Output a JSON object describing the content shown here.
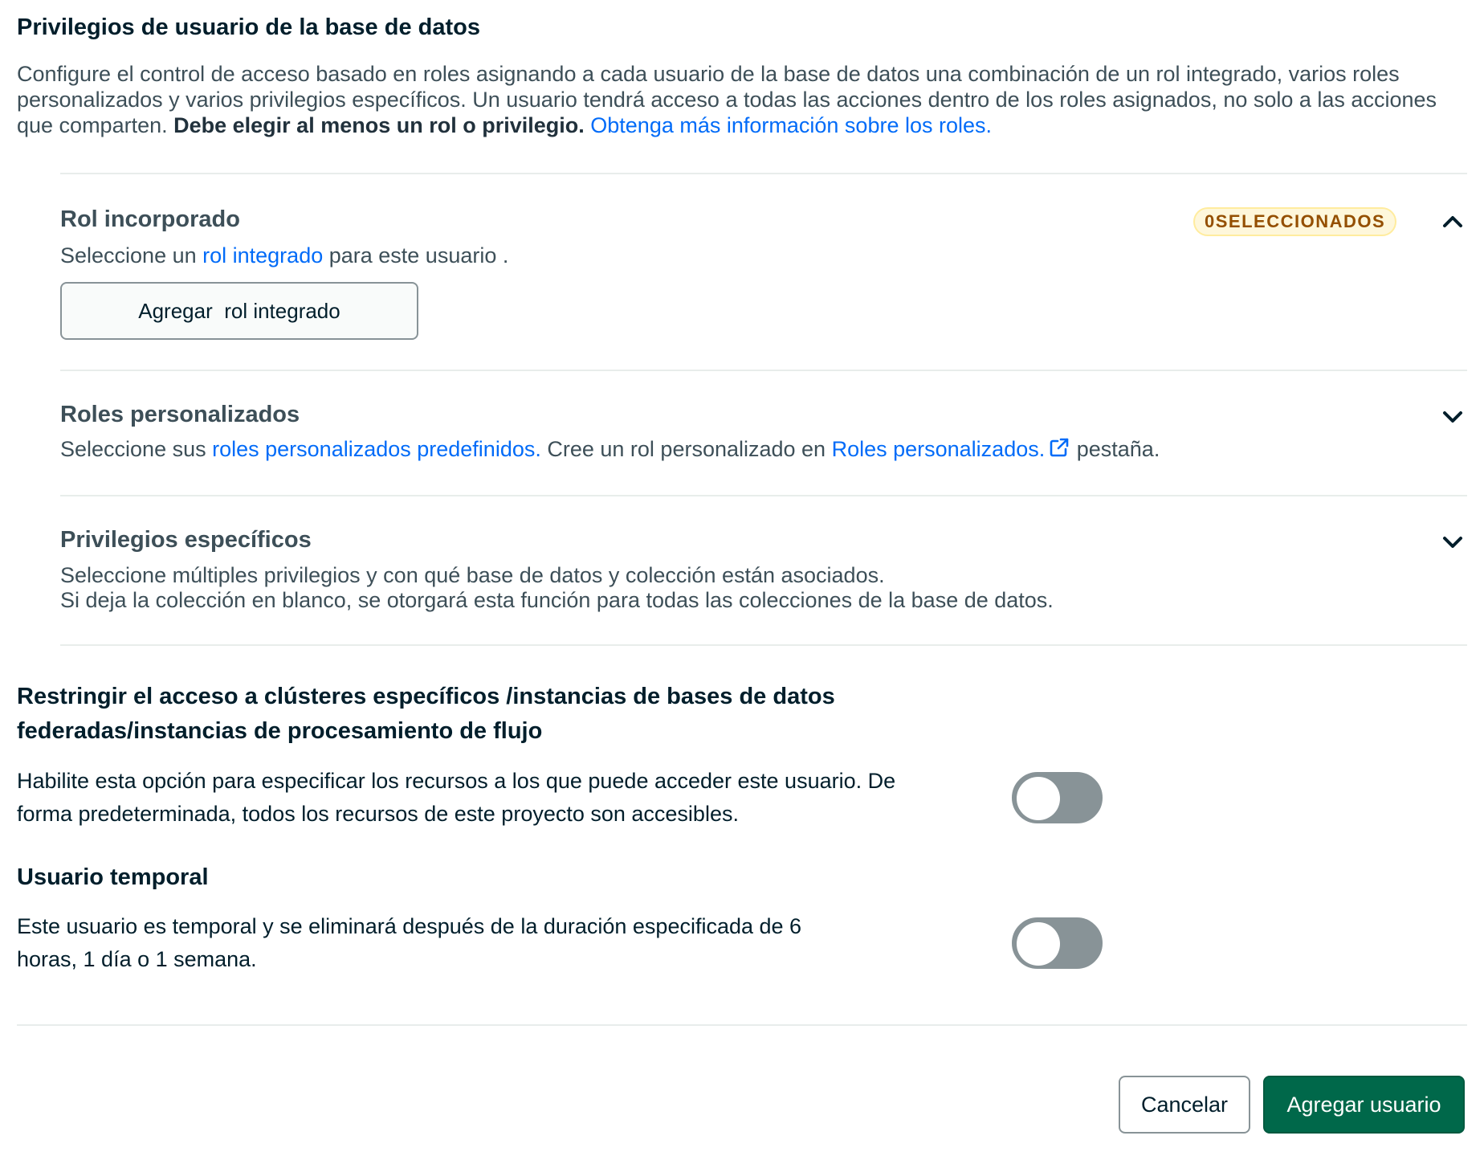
{
  "header": {
    "title": "Privilegios de usuario de la base de datos",
    "intro_part1": "Configure el control de acceso basado en roles asignando a cada usuario de la base de datos una combinación de un rol integrado, varios roles personalizados y varios privilegios específicos. Un usuario tendrá acceso a todas las acciones dentro de los roles asignados, no solo a las acciones que comparten. ",
    "intro_bold": "Debe elegir al menos un rol o privilegio.",
    "intro_link": "Obtenga más información sobre los roles."
  },
  "builtin_role": {
    "title": "Rol incorporado",
    "badge": "0SELECCIONADOS",
    "desc_prefix": "Seleccione un ",
    "desc_link": "rol integrado",
    "desc_suffix": " para este usuario .",
    "add_button": "Agregar  rol integrado",
    "chevron_icon": "chevron-up-icon"
  },
  "custom_roles": {
    "title": "Roles personalizados",
    "desc_prefix": "Seleccione sus ",
    "desc_link1": "roles personalizados predefinidos.",
    "desc_middle": " Cree un rol personalizado en ",
    "desc_link2": "Roles personalizados.",
    "desc_suffix": " pestaña.",
    "chevron_icon": "chevron-down-icon",
    "external_icon": "external-link-icon"
  },
  "specific_privileges": {
    "title": "Privilegios específicos",
    "desc_line1": "Seleccione múltiples privilegios y con qué base de datos y colección están asociados.",
    "desc_line2": "Si deja la colección en blanco, se otorgará esta función para todas las colecciones de la base de datos.",
    "chevron_icon": "chevron-down-icon"
  },
  "restrict_access": {
    "title_line1": "Restringir el acceso a clústeres específicos /instancias de bases de datos",
    "title_line2": "federadas/instancias de procesamiento de flujo",
    "desc_line1": "Habilite esta opción para especificar los recursos a los que puede acceder este usuario. De",
    "desc_line2": "forma predeterminada, todos los recursos de este proyecto son accesibles.",
    "toggle_on": false
  },
  "temporary_user": {
    "title": "Usuario temporal",
    "desc_line1": "Este usuario es temporal y se eliminará después de la duración especificada de 6",
    "desc_line2": "horas, 1 día o 1 semana.",
    "toggle_on": false
  },
  "footer": {
    "cancel_label": "Cancelar",
    "submit_label": "Agregar usuario"
  },
  "colors": {
    "link": "#016bf8",
    "primary": "#00684a",
    "toggle_off": "#889397",
    "badge_bg": "#fef7db",
    "badge_text": "#944f01"
  }
}
